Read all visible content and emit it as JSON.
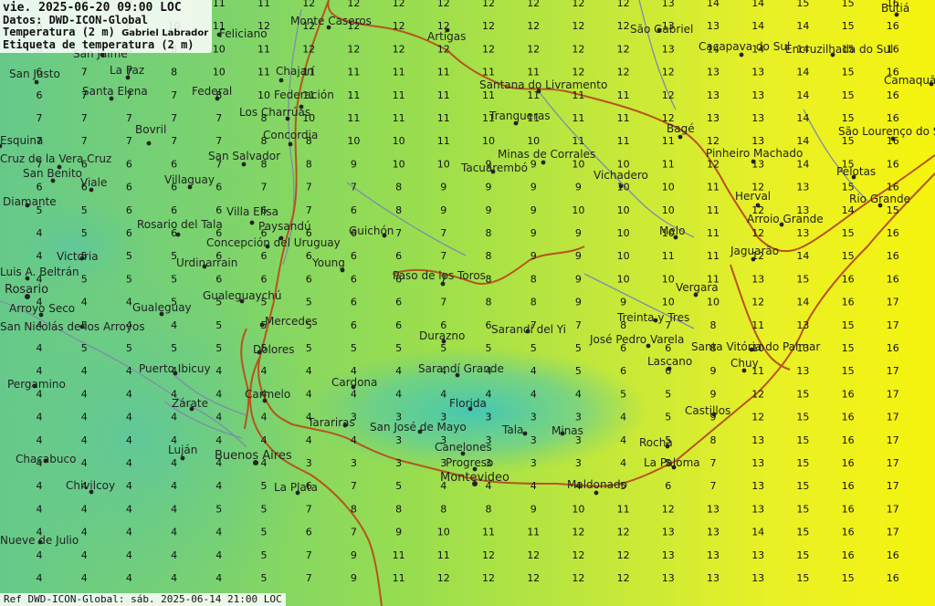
{
  "header": {
    "line1": "vie. 2025-06-20 09:00 LOC",
    "line2": "Datos: DWD-ICON-Global",
    "line3": "Temperatura (2 m)",
    "author": "Gabriel Labrador",
    "line4": "Etiqueta de temperatura (2 m)"
  },
  "footer": "Ref DWD-ICON-Global: sáb. 2025-06-14 21:00 LOC",
  "colors": {
    "cool": "#5cc48f",
    "mid": "#a6e24a",
    "warm": "#f4f40a",
    "cold_patch": "#45c9b4",
    "border": "#b5551c",
    "river": "#7a8fa8"
  },
  "temperature_grid": {
    "columns": 20,
    "rows": [
      [
        7,
        8,
        9,
        11,
        11,
        11,
        12,
        12,
        12,
        12,
        12,
        12,
        12,
        12,
        13,
        14,
        14,
        15,
        15,
        16
      ],
      [
        6,
        7,
        8,
        10,
        11,
        12,
        12,
        12,
        12,
        12,
        12,
        12,
        12,
        12,
        13,
        13,
        14,
        14,
        15,
        16
      ],
      [
        6,
        7,
        8,
        8,
        10,
        11,
        12,
        12,
        12,
        12,
        12,
        12,
        12,
        12,
        13,
        14,
        14,
        14,
        15,
        16
      ],
      [
        6,
        7,
        7,
        8,
        10,
        11,
        11,
        11,
        11,
        11,
        11,
        11,
        12,
        12,
        12,
        13,
        13,
        14,
        15,
        16
      ],
      [
        6,
        7,
        7,
        7,
        8,
        10,
        11,
        11,
        11,
        11,
        11,
        11,
        11,
        11,
        12,
        13,
        13,
        14,
        15,
        16
      ],
      [
        7,
        7,
        7,
        7,
        7,
        8,
        10,
        11,
        11,
        11,
        11,
        11,
        11,
        11,
        12,
        13,
        13,
        14,
        15,
        16
      ],
      [
        7,
        7,
        7,
        7,
        7,
        8,
        8,
        10,
        10,
        11,
        10,
        10,
        11,
        11,
        11,
        12,
        13,
        14,
        15,
        16
      ],
      [
        7,
        6,
        6,
        6,
        7,
        8,
        8,
        9,
        10,
        10,
        9,
        9,
        10,
        10,
        11,
        12,
        13,
        14,
        15,
        16
      ],
      [
        6,
        6,
        6,
        6,
        6,
        7,
        7,
        7,
        8,
        9,
        9,
        9,
        9,
        10,
        10,
        11,
        12,
        13,
        15,
        16
      ],
      [
        5,
        5,
        6,
        6,
        6,
        6,
        7,
        6,
        8,
        9,
        9,
        9,
        10,
        10,
        10,
        11,
        12,
        13,
        14,
        15
      ],
      [
        4,
        5,
        6,
        6,
        6,
        6,
        6,
        6,
        7,
        7,
        8,
        9,
        9,
        10,
        10,
        11,
        12,
        13,
        15,
        16
      ],
      [
        4,
        5,
        5,
        5,
        6,
        6,
        6,
        6,
        6,
        7,
        8,
        9,
        9,
        10,
        11,
        11,
        12,
        14,
        15,
        16
      ],
      [
        4,
        5,
        5,
        5,
        6,
        6,
        6,
        6,
        6,
        7,
        8,
        8,
        9,
        10,
        10,
        11,
        13,
        15,
        16,
        16
      ],
      [
        4,
        4,
        4,
        5,
        5,
        5,
        5,
        6,
        6,
        7,
        8,
        8,
        9,
        9,
        10,
        10,
        12,
        14,
        16,
        17
      ],
      [
        4,
        5,
        4,
        4,
        5,
        5,
        5,
        6,
        6,
        6,
        6,
        7,
        7,
        8,
        7,
        8,
        11,
        13,
        15,
        17
      ],
      [
        4,
        5,
        5,
        5,
        5,
        5,
        5,
        5,
        5,
        5,
        5,
        5,
        5,
        6,
        6,
        8,
        10,
        13,
        15,
        16
      ],
      [
        4,
        4,
        4,
        4,
        4,
        4,
        4,
        4,
        4,
        4,
        4,
        4,
        5,
        6,
        6,
        9,
        11,
        13,
        15,
        17
      ],
      [
        4,
        4,
        4,
        4,
        4,
        4,
        4,
        4,
        4,
        4,
        4,
        4,
        4,
        5,
        5,
        9,
        12,
        15,
        16,
        17
      ],
      [
        4,
        4,
        4,
        4,
        4,
        4,
        4,
        3,
        3,
        3,
        3,
        3,
        3,
        4,
        5,
        9,
        12,
        15,
        16,
        17
      ],
      [
        4,
        4,
        4,
        4,
        4,
        4,
        4,
        4,
        3,
        3,
        3,
        3,
        3,
        4,
        5,
        8,
        13,
        15,
        16,
        17
      ],
      [
        4,
        4,
        4,
        4,
        4,
        4,
        3,
        3,
        3,
        3,
        3,
        3,
        3,
        4,
        5,
        7,
        13,
        15,
        16,
        17
      ],
      [
        4,
        4,
        4,
        4,
        4,
        5,
        6,
        7,
        5,
        4,
        4,
        4,
        4,
        5,
        6,
        7,
        13,
        15,
        16,
        17
      ],
      [
        4,
        4,
        4,
        4,
        5,
        5,
        7,
        8,
        8,
        8,
        8,
        9,
        10,
        11,
        12,
        13,
        13,
        15,
        16,
        17
      ],
      [
        4,
        4,
        4,
        4,
        4,
        5,
        6,
        7,
        9,
        10,
        11,
        11,
        12,
        12,
        13,
        13,
        14,
        15,
        16,
        17
      ],
      [
        4,
        4,
        4,
        4,
        4,
        5,
        7,
        9,
        11,
        11,
        12,
        12,
        12,
        12,
        13,
        13,
        13,
        15,
        16,
        16
      ],
      [
        4,
        4,
        4,
        4,
        4,
        5,
        7,
        9,
        11,
        12,
        12,
        12,
        12,
        12,
        13,
        13,
        13,
        15,
        15,
        16
      ]
    ]
  },
  "cities": [
    {
      "name": "Monte Caseros",
      "big": false
    },
    {
      "name": "Artigas",
      "big": false
    },
    {
      "name": "São Gabriel",
      "big": false
    },
    {
      "name": "Caçapava do Sul",
      "big": false
    },
    {
      "name": "Encruzilhada do Sul",
      "big": false
    },
    {
      "name": "Butiá",
      "big": false
    },
    {
      "name": "Camaquã",
      "big": false
    },
    {
      "name": "Feliciano",
      "big": false
    },
    {
      "name": "San Jaime",
      "big": false
    },
    {
      "name": "San Justo",
      "big": false
    },
    {
      "name": "La Paz",
      "big": false
    },
    {
      "name": "Chajarí",
      "big": false
    },
    {
      "name": "Federación",
      "big": false
    },
    {
      "name": "Federal",
      "big": false
    },
    {
      "name": "Santa Elena",
      "big": false
    },
    {
      "name": "Los Charrúas",
      "big": false
    },
    {
      "name": "Santana do Livramento",
      "big": false
    },
    {
      "name": "Tranqueras",
      "big": false
    },
    {
      "name": "Bagé",
      "big": false
    },
    {
      "name": "São Lourenço do Sul",
      "big": false
    },
    {
      "name": "Bovril",
      "big": false
    },
    {
      "name": "Concordia",
      "big": false
    },
    {
      "name": "Esquina",
      "big": false
    },
    {
      "name": "Minas de Corrales",
      "big": false
    },
    {
      "name": "Pinheiro Machado",
      "big": false
    },
    {
      "name": "Pelotas",
      "big": false
    },
    {
      "name": "Rio Grande",
      "big": false
    },
    {
      "name": "Cruz de la Vera Cruz",
      "big": false
    },
    {
      "name": "San Salvador",
      "big": false
    },
    {
      "name": "Tacuarembó",
      "big": false
    },
    {
      "name": "Vichadero",
      "big": false
    },
    {
      "name": "San Benito",
      "big": false
    },
    {
      "name": "Viale",
      "big": false
    },
    {
      "name": "Villaguay",
      "big": false
    },
    {
      "name": "Herval",
      "big": false
    },
    {
      "name": "Diamante",
      "big": false
    },
    {
      "name": "Villa Elisa",
      "big": false
    },
    {
      "name": "Arroio Grande",
      "big": false
    },
    {
      "name": "Rosario del Tala",
      "big": false
    },
    {
      "name": "Paysandú",
      "big": false
    },
    {
      "name": "Guichón",
      "big": false
    },
    {
      "name": "Melo",
      "big": false
    },
    {
      "name": "Victoria",
      "big": false
    },
    {
      "name": "Concepción del Uruguay",
      "big": false
    },
    {
      "name": "Jaguarão",
      "big": false
    },
    {
      "name": "Urdinarrain",
      "big": false
    },
    {
      "name": "Young",
      "big": false
    },
    {
      "name": "Luis A. Beltrán",
      "big": false
    },
    {
      "name": "Paso de los Toros",
      "big": false
    },
    {
      "name": "Rosario",
      "big": true
    },
    {
      "name": "Gualeguaychú",
      "big": false
    },
    {
      "name": "Vergara",
      "big": false
    },
    {
      "name": "Arroyo Seco",
      "big": false
    },
    {
      "name": "Gualeguay",
      "big": false
    },
    {
      "name": "Mercedes",
      "big": false
    },
    {
      "name": "Treinta y Tres",
      "big": false
    },
    {
      "name": "San Nicolás de los Arroyos",
      "big": false
    },
    {
      "name": "Sarandí del Yi",
      "big": false
    },
    {
      "name": "Durazno",
      "big": false
    },
    {
      "name": "José Pedro Varela",
      "big": false
    },
    {
      "name": "Dolores",
      "big": false
    },
    {
      "name": "Santa Vitória do Palmar",
      "big": false
    },
    {
      "name": "Lascano",
      "big": false
    },
    {
      "name": "Chuy",
      "big": false
    },
    {
      "name": "Puerto Ibicuy",
      "big": false
    },
    {
      "name": "Sarandí Grande",
      "big": false
    },
    {
      "name": "Pergamino",
      "big": false
    },
    {
      "name": "Cardona",
      "big": false
    },
    {
      "name": "Carmelo",
      "big": false
    },
    {
      "name": "Zárate",
      "big": false
    },
    {
      "name": "Florida",
      "big": false
    },
    {
      "name": "Castillos",
      "big": false
    },
    {
      "name": "Tarariras",
      "big": false
    },
    {
      "name": "San José de Mayo",
      "big": false
    },
    {
      "name": "Tala",
      "big": false
    },
    {
      "name": "Minas",
      "big": false
    },
    {
      "name": "Rocha",
      "big": false
    },
    {
      "name": "Canelones",
      "big": false
    },
    {
      "name": "Luján",
      "big": false
    },
    {
      "name": "Buenos Aires",
      "big": true
    },
    {
      "name": "Chacabuco",
      "big": false
    },
    {
      "name": "Progreso",
      "big": false
    },
    {
      "name": "La Paloma",
      "big": false
    },
    {
      "name": "Montevideo",
      "big": true
    },
    {
      "name": "Chivilcoy",
      "big": false
    },
    {
      "name": "Maldonado",
      "big": false
    },
    {
      "name": "La Plata",
      "big": false
    },
    {
      "name": "Nueve de Julio",
      "big": false
    }
  ]
}
